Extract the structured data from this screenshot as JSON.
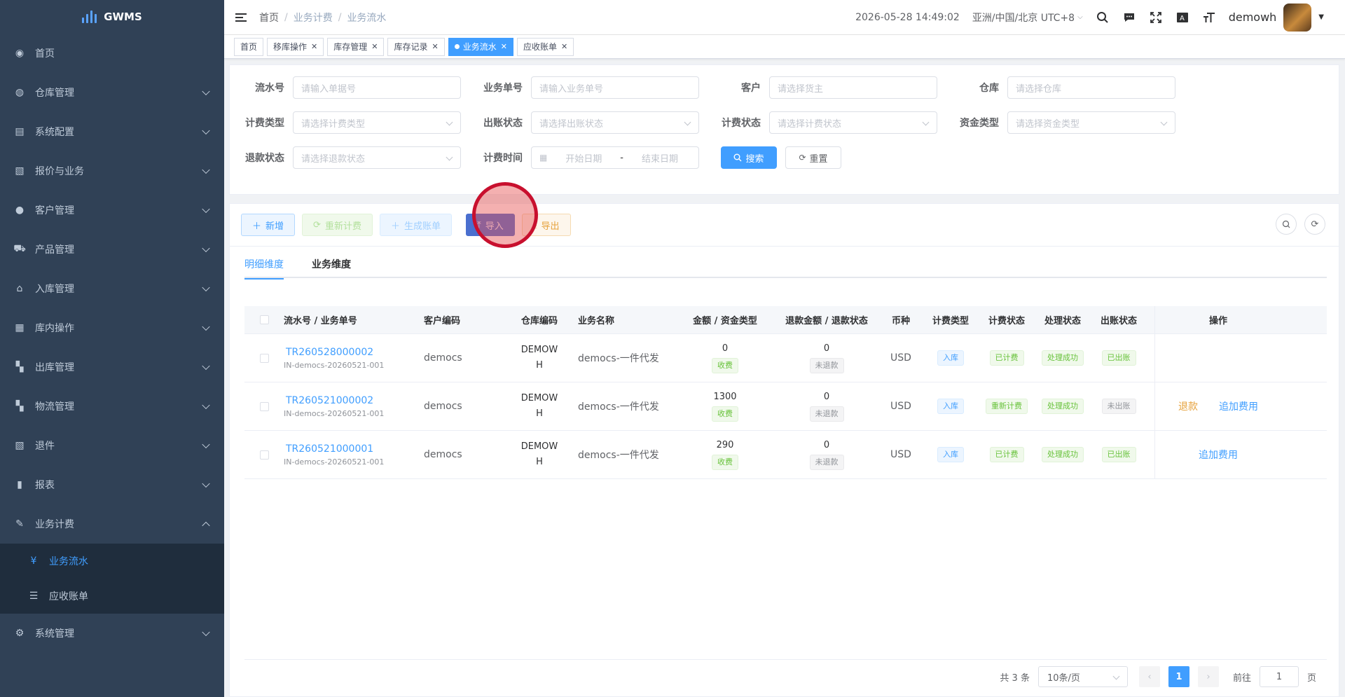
{
  "app": {
    "name": "GWMS"
  },
  "sidebar": {
    "items": [
      {
        "label": "首页",
        "icon": "dashboard-icon",
        "glyph": "◉",
        "chevron": false
      },
      {
        "label": "仓库管理",
        "icon": "globe-icon",
        "glyph": "◍",
        "chevron": true
      },
      {
        "label": "系统配置",
        "icon": "config-icon",
        "glyph": "▤",
        "chevron": true
      },
      {
        "label": "报价与业务",
        "icon": "document-icon",
        "glyph": "▧",
        "chevron": true
      },
      {
        "label": "客户管理",
        "icon": "user-icon",
        "glyph": "●",
        "chevron": true
      },
      {
        "label": "产品管理",
        "icon": "cart-icon",
        "glyph": "⛟",
        "chevron": true
      },
      {
        "label": "入库管理",
        "icon": "home-icon",
        "glyph": "⌂",
        "chevron": true
      },
      {
        "label": "库内操作",
        "icon": "grid-icon",
        "glyph": "▦",
        "chevron": true
      },
      {
        "label": "出库管理",
        "icon": "apps-icon",
        "glyph": "▚",
        "chevron": true
      },
      {
        "label": "物流管理",
        "icon": "apps-icon",
        "glyph": "▚",
        "chevron": true
      },
      {
        "label": "退件",
        "icon": "document-icon",
        "glyph": "▧",
        "chevron": true
      },
      {
        "label": "报表",
        "icon": "bar-chart-icon",
        "glyph": "▮",
        "chevron": true
      },
      {
        "label": "业务计费",
        "icon": "edit-icon",
        "glyph": "✎",
        "chevron": true,
        "expanded": true
      }
    ],
    "sub_items": [
      {
        "label": "业务流水",
        "icon": "yen-icon",
        "glyph": "¥",
        "active": true
      },
      {
        "label": "应收账单",
        "icon": "list-icon",
        "glyph": "☰",
        "active": false
      }
    ],
    "bottom_item": {
      "label": "系统管理",
      "icon": "gear-icon",
      "glyph": "⚙"
    }
  },
  "header": {
    "breadcrumb": [
      "首页",
      "业务计费",
      "业务流水"
    ],
    "datetime": "2026-05-28 14:49:02",
    "timezone": "亚洲/中国/北京 UTC+8",
    "username": "demowh"
  },
  "tags": [
    {
      "label": "首页",
      "closable": false,
      "active": false
    },
    {
      "label": "移库操作",
      "closable": true,
      "active": false
    },
    {
      "label": "库存管理",
      "closable": true,
      "active": false
    },
    {
      "label": "库存记录",
      "closable": true,
      "active": false
    },
    {
      "label": "业务流水",
      "closable": true,
      "active": true
    },
    {
      "label": "应收账单",
      "closable": true,
      "active": false
    }
  ],
  "search": {
    "serial_no": {
      "label": "流水号",
      "placeholder": "请输入单据号"
    },
    "business_no": {
      "label": "业务单号",
      "placeholder": "请输入业务单号"
    },
    "customer": {
      "label": "客户",
      "placeholder": "请选择货主"
    },
    "warehouse": {
      "label": "仓库",
      "placeholder": "请选择仓库"
    },
    "billing_type": {
      "label": "计费类型",
      "placeholder": "请选择计费类型"
    },
    "bill_status": {
      "label": "出账状态",
      "placeholder": "请选择出账状态"
    },
    "billing_status": {
      "label": "计费状态",
      "placeholder": "请选择计费状态"
    },
    "fund_type": {
      "label": "资金类型",
      "placeholder": "请选择资金类型"
    },
    "refund_status": {
      "label": "退款状态",
      "placeholder": "请选择退款状态"
    },
    "billing_time": {
      "label": "计费时间",
      "start_placeholder": "开始日期",
      "separator": "-",
      "end_placeholder": "结束日期"
    },
    "search_button": "搜索",
    "reset_button": "重置"
  },
  "toolbar": {
    "add": "新增",
    "recalc": "重新计费",
    "generate_bill": "生成账单",
    "import": "导入",
    "export": "导出"
  },
  "tabs": [
    {
      "label": "明细维度",
      "active": true
    },
    {
      "label": "业务维度",
      "active": false
    }
  ],
  "table": {
    "headers": {
      "serial": "流水号 / 业务单号",
      "customer_code": "客户编码",
      "warehouse_code": "仓库编码",
      "business_name": "业务名称",
      "amount": "金额 / 资金类型",
      "refund": "退款金额 / 退款状态",
      "currency": "币种",
      "billing_type": "计费类型",
      "billing_status": "计费状态",
      "process_status": "处理状态",
      "bill_status": "出账状态",
      "ops": "操作"
    },
    "rows": [
      {
        "serial": "TR260528000002",
        "business_no": "IN-democs-20260521-001",
        "customer_code": "democs",
        "warehouse_code_1": "DEMOW",
        "warehouse_code_2": "H",
        "business_name": "democs-一件代发",
        "amount": "0",
        "fund_type": "收费",
        "refund_amount": "0",
        "refund_status": "未退款",
        "currency": "USD",
        "billing_type": "入库",
        "billing_status": "已计费",
        "process_status": "处理成功",
        "bill_status": "已出账",
        "bill_status_kind": "green",
        "ops": []
      },
      {
        "serial": "TR260521000002",
        "business_no": "IN-democs-20260521-001",
        "customer_code": "democs",
        "warehouse_code_1": "DEMOW",
        "warehouse_code_2": "H",
        "business_name": "democs-一件代发",
        "amount": "1300",
        "fund_type": "收费",
        "refund_amount": "0",
        "refund_status": "未退款",
        "currency": "USD",
        "billing_type": "入库",
        "billing_status": "重新计费",
        "process_status": "处理成功",
        "bill_status": "未出账",
        "bill_status_kind": "gray",
        "ops": [
          {
            "label": "退款",
            "kind": "warn"
          },
          {
            "label": "追加费用",
            "kind": "link"
          }
        ]
      },
      {
        "serial": "TR260521000001",
        "business_no": "IN-democs-20260521-001",
        "customer_code": "democs",
        "warehouse_code_1": "DEMOW",
        "warehouse_code_2": "H",
        "business_name": "democs-一件代发",
        "amount": "290",
        "fund_type": "收费",
        "refund_amount": "0",
        "refund_status": "未退款",
        "currency": "USD",
        "billing_type": "入库",
        "billing_status": "已计费",
        "process_status": "处理成功",
        "bill_status": "已出账",
        "bill_status_kind": "green",
        "ops": [
          {
            "label": "追加费用",
            "kind": "link"
          }
        ]
      }
    ]
  },
  "pagination": {
    "total": "共 3 条",
    "page_size": "10条/页",
    "current_page": "1",
    "goto_label": "前往",
    "goto_value": "1",
    "page_suffix": "页"
  }
}
